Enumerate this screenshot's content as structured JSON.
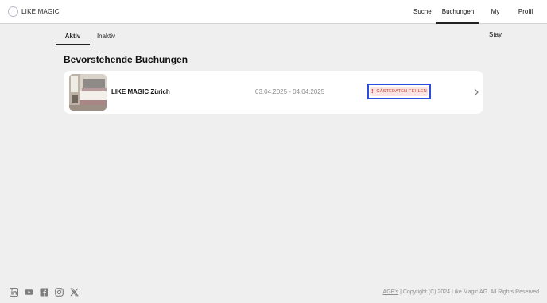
{
  "brand": {
    "name": "LIKE MAGIC"
  },
  "nav": {
    "items": [
      {
        "label": "Suche"
      },
      {
        "label": "Buchungen",
        "active": true
      },
      {
        "label": "My Stay"
      },
      {
        "label": "Profil"
      }
    ]
  },
  "tabs": [
    {
      "label": "Aktiv",
      "active": true
    },
    {
      "label": "Inaktiv"
    }
  ],
  "section": {
    "title": "Bevorstehende Buchungen"
  },
  "bookings": [
    {
      "hotel": "LIKE MAGIC Zürich",
      "dates": "03.04.2025 - 04.04.2025",
      "warning": {
        "icon": "!",
        "label": "GÄSTEDATEN FEHLEN"
      }
    }
  ],
  "footer": {
    "social_icons": [
      "linkedin-icon",
      "youtube-icon",
      "facebook-icon",
      "instagram-icon",
      "x-icon"
    ],
    "agb_label": "AGB's",
    "copyright": " | Copyright (C) 2024 Like Magic AG. All Rights Reserved."
  },
  "colors": {
    "background": "#efefef",
    "accent_border": "#2b4ee0",
    "warning_bg": "#fbe3e3",
    "warning_text": "#c0392b"
  }
}
